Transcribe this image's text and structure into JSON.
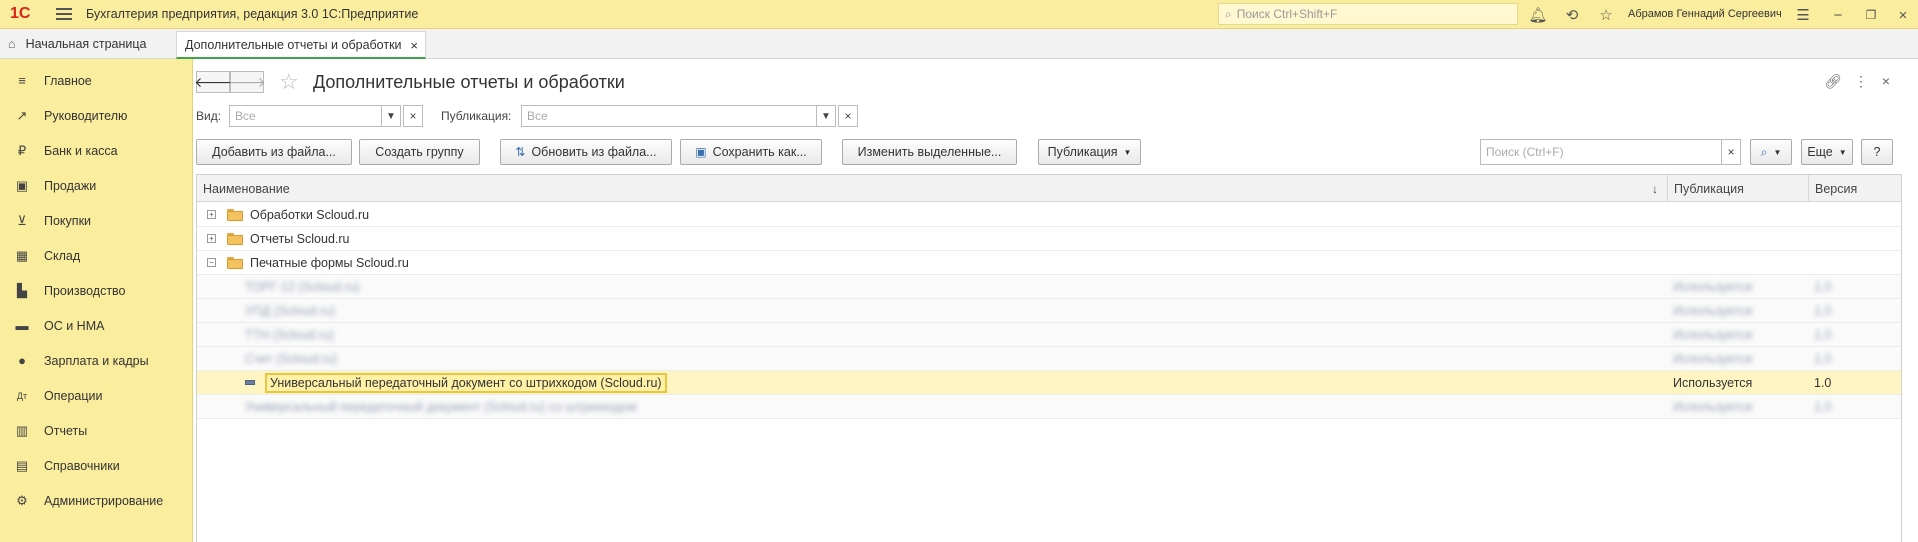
{
  "app": {
    "title": "Бухгалтерия предприятия, редакция 3.0 1С:Предприятие",
    "logo": "1С",
    "search_placeholder": "Поиск Ctrl+Shift+F",
    "user": "Абрамов Геннадий Сергеевич"
  },
  "tabs": {
    "home": "Начальная страница",
    "active": "Дополнительные отчеты и обработки"
  },
  "sidebar": {
    "items": [
      {
        "label": "Главное",
        "icon": "menu-icon"
      },
      {
        "label": "Руководителю",
        "icon": "trend-icon"
      },
      {
        "label": "Банк и касса",
        "icon": "ruble-icon"
      },
      {
        "label": "Продажи",
        "icon": "bag-icon"
      },
      {
        "label": "Покупки",
        "icon": "cart-icon"
      },
      {
        "label": "Склад",
        "icon": "warehouse-icon"
      },
      {
        "label": "Производство",
        "icon": "factory-icon"
      },
      {
        "label": "ОС и НМА",
        "icon": "truck-icon"
      },
      {
        "label": "Зарплата и кадры",
        "icon": "person-icon"
      },
      {
        "label": "Операции",
        "icon": "dt-kt-icon"
      },
      {
        "label": "Отчеты",
        "icon": "bar-chart-icon"
      },
      {
        "label": "Справочники",
        "icon": "books-icon"
      },
      {
        "label": "Администрирование",
        "icon": "gear-icon"
      }
    ]
  },
  "page": {
    "title": "Дополнительные отчеты и обработки"
  },
  "filters": {
    "vid_label": "Вид:",
    "vid_value": "Все",
    "pub_label": "Публикация:",
    "pub_value": "Все"
  },
  "toolbar": {
    "add_from_file": "Добавить из файла...",
    "create_group": "Создать группу",
    "update_from_file": "Обновить из файла...",
    "save_as": "Сохранить как...",
    "change_selected": "Изменить выделенные...",
    "publication": "Публикация",
    "search_placeholder": "Поиск (Ctrl+F)",
    "more": "Еще",
    "help": "?"
  },
  "table": {
    "columns": [
      "Наименование",
      "Публикация",
      "Версия"
    ],
    "groups": [
      {
        "name": "Обработки Scloud.ru",
        "expander": "+"
      },
      {
        "name": "Отчеты Scloud.ru",
        "expander": "+"
      },
      {
        "name": "Печатные формы Scloud.ru",
        "expander": "−"
      }
    ],
    "blurred_rows": [
      {
        "name": "ТОРГ-12 (Scloud.ru)",
        "publication": "Используется",
        "version": "1.0"
      },
      {
        "name": "УПД (Scloud.ru)",
        "publication": "Используется",
        "version": "1.0"
      },
      {
        "name": "ТТН (Scloud.ru)",
        "publication": "Используется",
        "version": "1.0"
      },
      {
        "name": "Счет (Scloud.ru)",
        "publication": "Используется",
        "version": "1.0"
      }
    ],
    "selected_row": {
      "name": "Универсальный передаточный документ со штрихкодом (Scloud.ru)",
      "publication": "Используется",
      "version": "1.0"
    },
    "last_row": {
      "name": "Универсальный передаточный документ (Scloud.ru) со штрихкодом",
      "publication": "Используется",
      "version": "1.0"
    }
  }
}
